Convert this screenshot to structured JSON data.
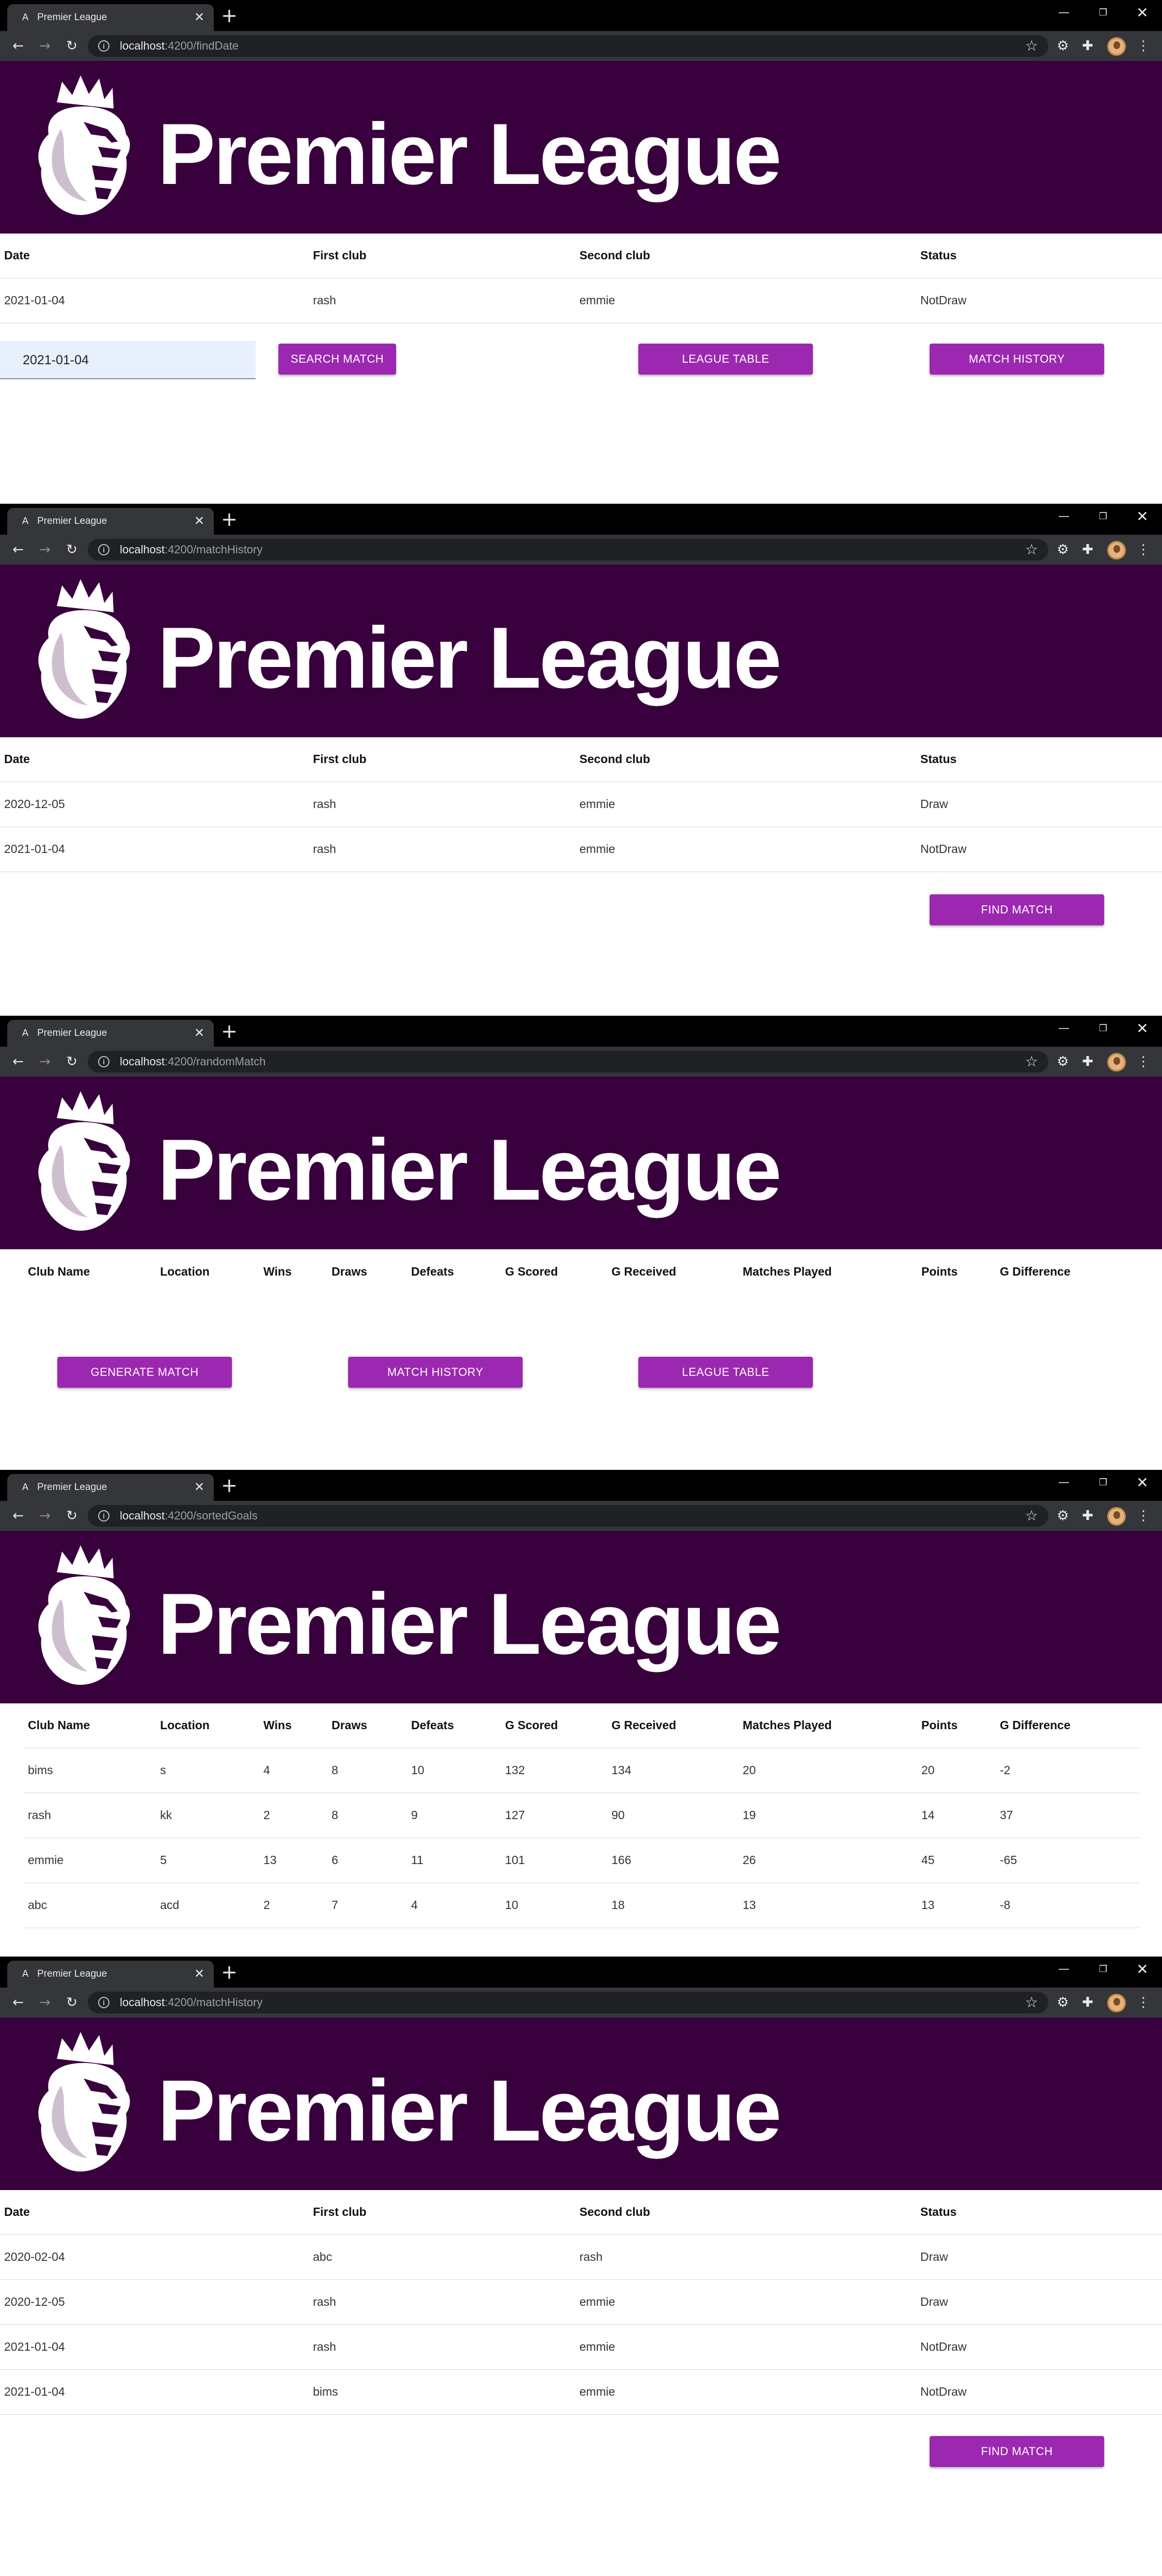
{
  "browser": {
    "tab_title": "Premier League",
    "url_host": "localhost",
    "window_buttons": {
      "minimize": "—",
      "restore": "❐",
      "close": "✕"
    }
  },
  "banner": {
    "brand_text": "Premier League",
    "colors": {
      "background": "#38003c",
      "button": "#9c27b0"
    }
  },
  "screens": [
    {
      "url_rest": ":4200/findDate",
      "columns": [
        "Date",
        "First club",
        "Second club",
        "Status"
      ],
      "rows": [
        [
          "2021-01-04",
          "rash",
          "emmie",
          "NotDraw"
        ]
      ],
      "date_input_value": "2021-01-04",
      "buttons": [
        "SEARCH MATCH",
        "LEAGUE TABLE",
        "MATCH HISTORY"
      ]
    },
    {
      "url_rest": ":4200/matchHistory",
      "columns": [
        "Date",
        "First club",
        "Second club",
        "Status"
      ],
      "rows": [
        [
          "2020-12-05",
          "rash",
          "emmie",
          "Draw"
        ],
        [
          "2021-01-04",
          "rash",
          "emmie",
          "NotDraw"
        ]
      ],
      "buttons": [
        "FIND MATCH"
      ]
    },
    {
      "url_rest": ":4200/randomMatch",
      "columns": [
        "Club Name",
        "Location",
        "Wins",
        "Draws",
        "Defeats",
        "G Scored",
        "G Received",
        "Matches Played",
        "Points",
        "G Difference"
      ],
      "rows": [],
      "buttons": [
        "GENERATE MATCH",
        "MATCH HISTORY",
        "LEAGUE TABLE"
      ]
    },
    {
      "url_rest": ":4200/sortedGoals",
      "columns": [
        "Club Name",
        "Location",
        "Wins",
        "Draws",
        "Defeats",
        "G Scored",
        "G Received",
        "Matches Played",
        "Points",
        "G Difference"
      ],
      "rows": [
        [
          "bims",
          "s",
          "4",
          "8",
          "10",
          "132",
          "134",
          "20",
          "20",
          "-2"
        ],
        [
          "rash",
          "kk",
          "2",
          "8",
          "9",
          "127",
          "90",
          "19",
          "14",
          "37"
        ],
        [
          "emmie",
          "5",
          "13",
          "6",
          "11",
          "101",
          "166",
          "26",
          "45",
          "-65"
        ],
        [
          "abc",
          "acd",
          "2",
          "7",
          "4",
          "10",
          "18",
          "13",
          "13",
          "-8"
        ]
      ],
      "buttons": []
    },
    {
      "url_rest": ":4200/matchHistory",
      "columns": [
        "Date",
        "First club",
        "Second club",
        "Status"
      ],
      "rows": [
        [
          "2020-02-04",
          "abc",
          "rash",
          "Draw"
        ],
        [
          "2020-12-05",
          "rash",
          "emmie",
          "Draw"
        ],
        [
          "2021-01-04",
          "rash",
          "emmie",
          "NotDraw"
        ],
        [
          "2021-01-04",
          "bims",
          "emmie",
          "NotDraw"
        ]
      ],
      "buttons": [
        "FIND MATCH"
      ]
    }
  ]
}
